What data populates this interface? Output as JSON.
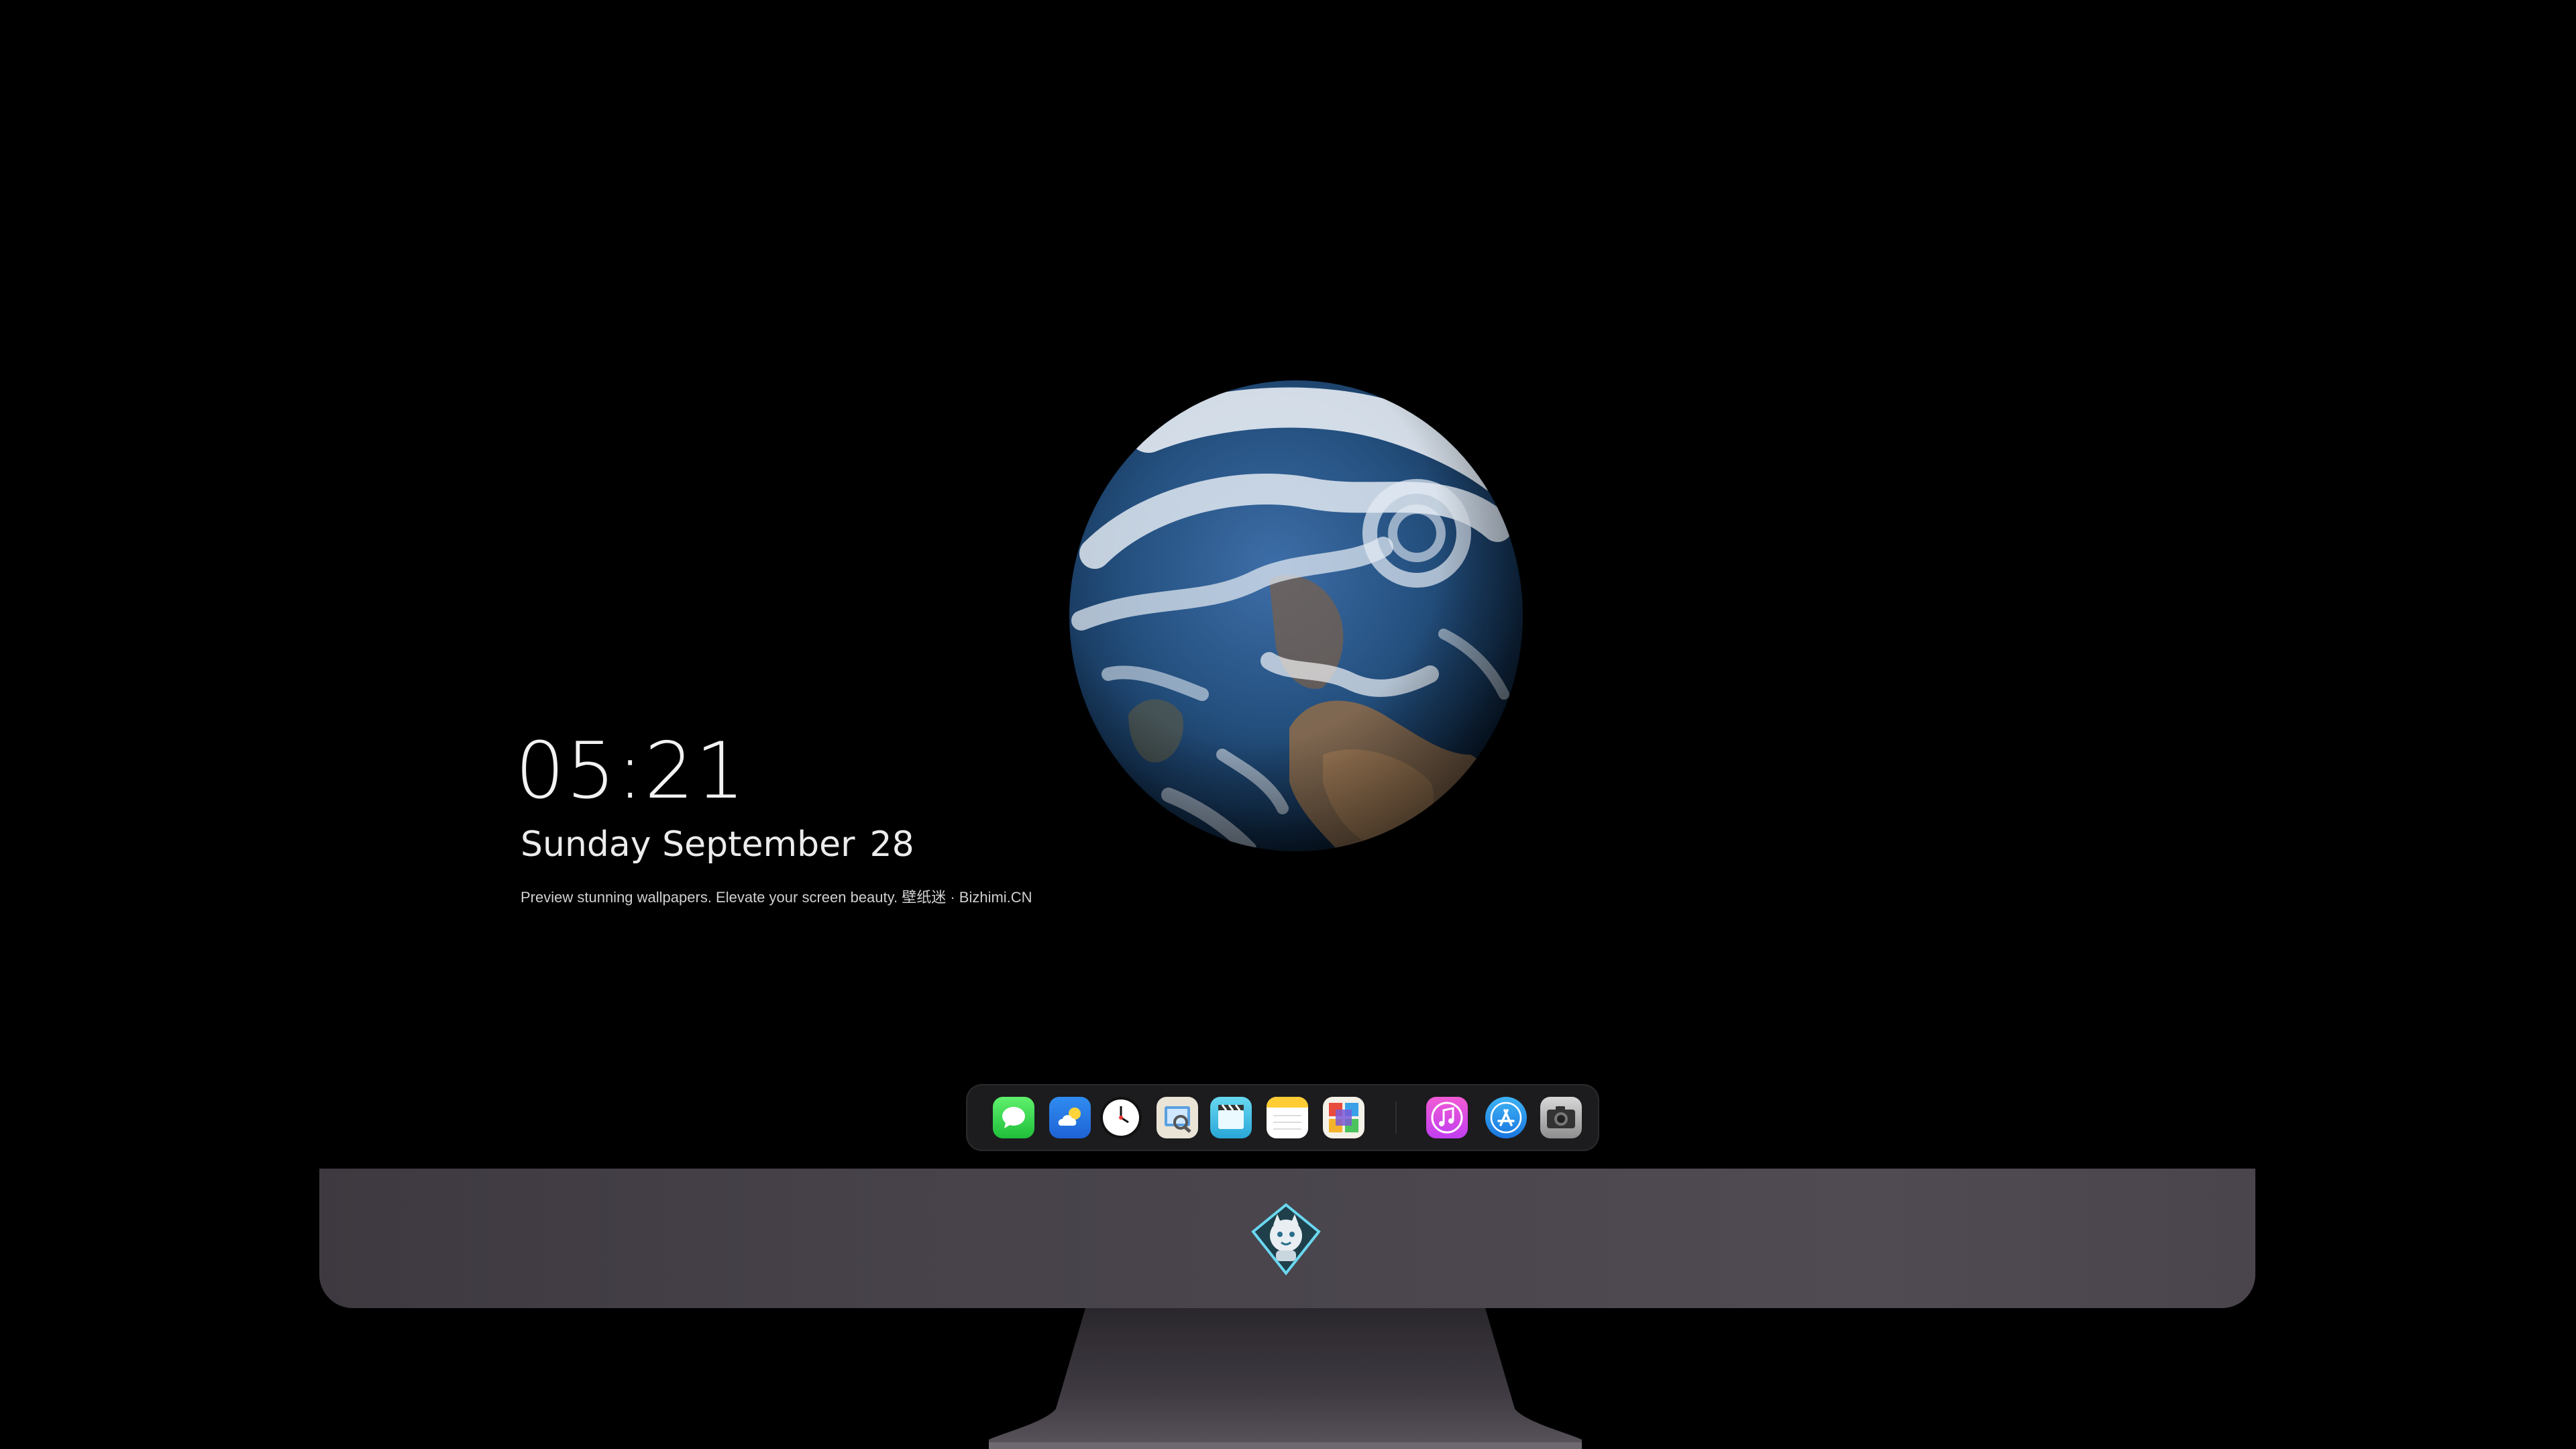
{
  "wallpaper": {
    "subject": "earth-globe"
  },
  "clock": {
    "time": "05:21",
    "weekday_month": "Sunday September",
    "day": "28",
    "caption": "Preview stunning wallpapers. Elevate your screen beauty. 壁纸迷 · Bizhimi.CN"
  },
  "dock": {
    "apps": [
      {
        "name": "Messages",
        "icon": "messages-icon"
      },
      {
        "name": "Weather",
        "icon": "weather-icon"
      },
      {
        "name": "Clock",
        "icon": "clock-icon"
      },
      {
        "name": "Preview",
        "icon": "preview-icon"
      },
      {
        "name": "Clips",
        "icon": "clips-icon"
      },
      {
        "name": "Notes",
        "icon": "notes-icon"
      },
      {
        "name": "Photo Booth",
        "icon": "photo-booth-icon"
      },
      {
        "name": "iTunes",
        "icon": "music-icon"
      },
      {
        "name": "App Store",
        "icon": "app-store-icon"
      },
      {
        "name": "Camera",
        "icon": "camera-icon"
      }
    ]
  },
  "monitor": {
    "logo": "bizhimi-mascot-logo"
  },
  "colors": {
    "background": "#000000",
    "chin": "#47424a",
    "dock": "#1c1c1e",
    "clock_text": "#f2f2f2"
  }
}
